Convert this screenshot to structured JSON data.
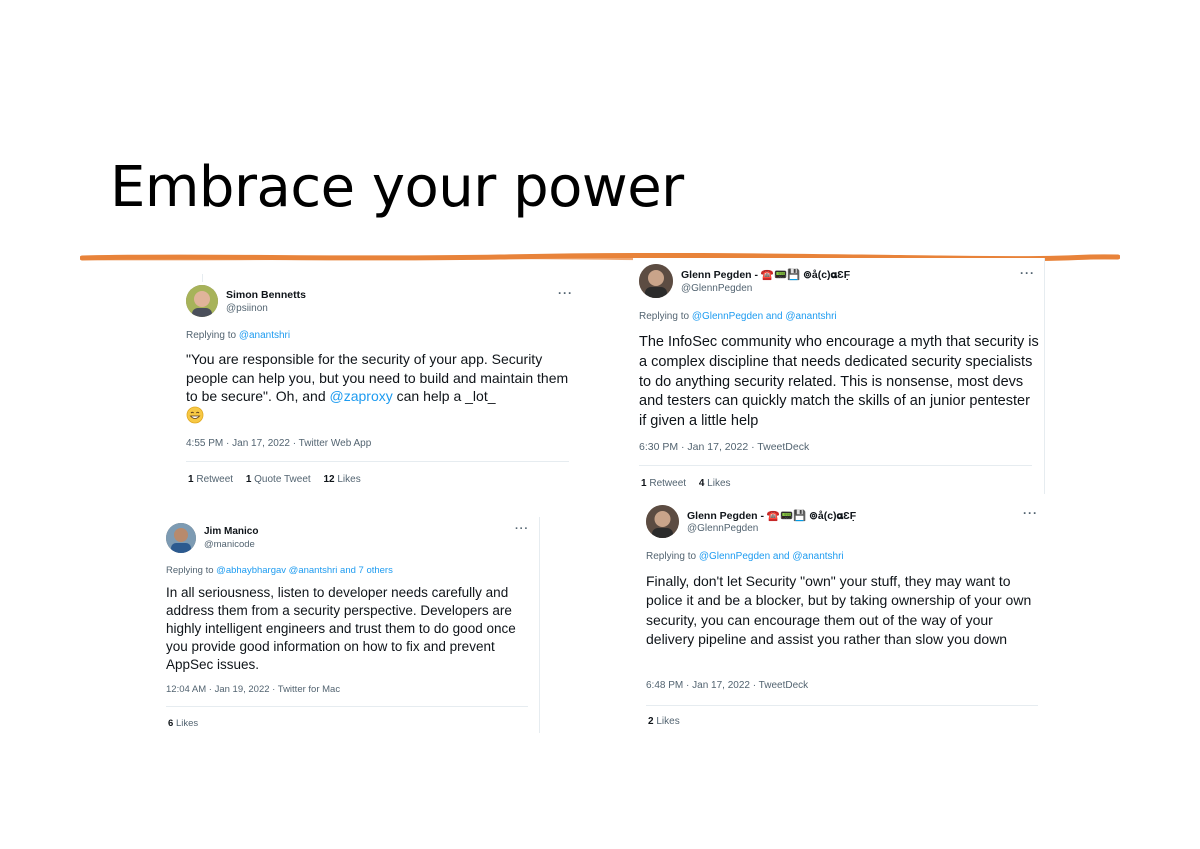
{
  "slide": {
    "title": "Embrace your power",
    "divider_color": "#e8833a"
  },
  "icons": {
    "more": "more-options-icon",
    "emoji": "grinning-emoji"
  },
  "tweets": {
    "simon": {
      "name": "Simon Bennetts",
      "handle": "@psiinon",
      "replying_prefix": "Replying to",
      "replying_to": "@anantshri",
      "text_1": "\"You are responsible for the security of your app. Security people can help you, but you need to build and maintain them to be secure\". Oh, and",
      "mention": "@zaproxy",
      "text_2": "can help a _lot_",
      "meta": "4:55 PM · Jan 17, 2022 · Twitter Web App",
      "retweets": "1",
      "retweets_label": "Retweet",
      "quotes": "1",
      "quotes_label": "Quote Tweet",
      "likes": "12",
      "likes_label": "Likes"
    },
    "glenn1": {
      "name": "Glenn Pegden - ☎️📟💾 ⊚å(c)𝛂ƐF̣",
      "handle": "@GlennPegden",
      "replying_prefix": "Replying to",
      "replying_to": "@GlennPegden and @anantshri",
      "text": "The InfoSec community who encourage a myth that security is a complex discipline that needs dedicated security specialists to do anything security related. This is nonsense, most devs and testers can quickly match the skills of an junior pentester if given a little help",
      "meta": "6:30 PM · Jan 17, 2022 · TweetDeck",
      "retweets": "1",
      "retweets_label": "Retweet",
      "likes": "4",
      "likes_label": "Likes"
    },
    "jim": {
      "name": "Jim Manico",
      "handle": "@manicode",
      "replying_prefix": "Replying to",
      "replying_to": "@abhaybhargav @anantshri and 7 others",
      "text": "In all seriousness, listen to developer needs carefully and address them from a security perspective. Developers are highly intelligent engineers and trust them to do good once you provide good information on how to fix and prevent AppSec issues.",
      "meta": "12:04 AM · Jan 19, 2022 · Twitter for Mac",
      "likes": "6",
      "likes_label": "Likes"
    },
    "glenn2": {
      "name": "Glenn Pegden - ☎️📟💾 ⊚å(c)𝛂ƐF̣",
      "handle": "@GlennPegden",
      "replying_prefix": "Replying to",
      "replying_to": "@GlennPegden and @anantshri",
      "text": "Finally, don't let Security \"own\" your stuff, they may want to police it and be a blocker, but by taking ownership of your own security, you can encourage them out of the way of your delivery pipeline and assist you rather than slow you down",
      "meta": "6:48 PM · Jan 17, 2022 · TweetDeck",
      "likes": "2",
      "likes_label": "Likes"
    }
  }
}
